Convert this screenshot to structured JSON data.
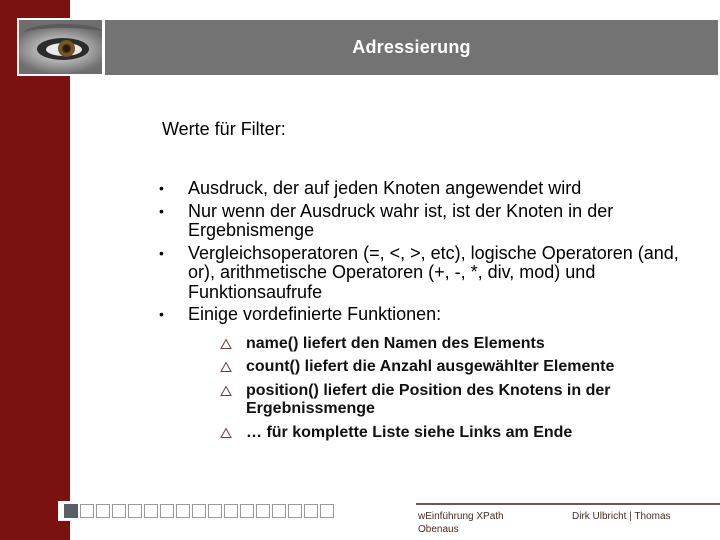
{
  "header": {
    "title": "Adressierung",
    "image": "eye-photo"
  },
  "content": {
    "heading": "Werte für Filter:",
    "bullets": [
      "Ausdruck, der auf jeden Knoten angewendet wird",
      "Nur wenn der Ausdruck wahr ist, ist der Knoten in der Ergebnismenge",
      "Vergleichsoperatoren (=, <, >, etc), logische Operatoren (and, or), arithmetische Operatoren (+, -, *, div, mod) und Funktionsaufrufe",
      "Einige vordefinierte Funktionen:"
    ],
    "bullet_glyph": "•",
    "sub_bullets": [
      "name() liefert den Namen des Elements",
      "count() liefert die Anzahl ausgewählter Elemente",
      "position() liefert die Position des Knotens in der Ergebnissmenge",
      "… für komplette Liste siehe Links am Ende"
    ],
    "sub_bullet_icon": "triangle-outline-icon"
  },
  "footer": {
    "left_text": "wEinführung XPath",
    "left_text_line2": "Obenaus",
    "right_text": "Dirk Ulbricht | Thomas",
    "slide_indicator": {
      "total": 17,
      "current": 1
    }
  },
  "colors": {
    "accent_red": "#7a1211",
    "title_bar": "#737373",
    "title_text": "#ffffff"
  }
}
